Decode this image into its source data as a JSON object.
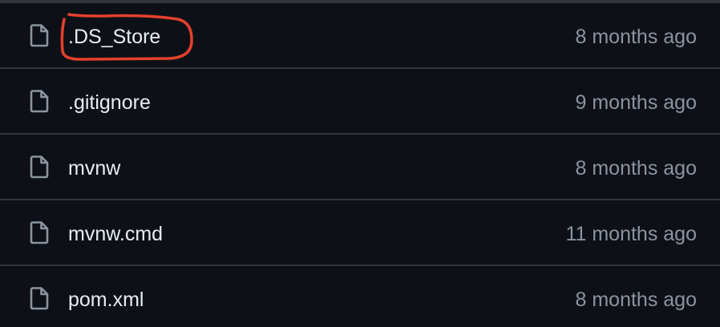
{
  "files": [
    {
      "name": ".DS_Store",
      "age": "8 months ago",
      "icon": "file-icon",
      "annotated": true
    },
    {
      "name": ".gitignore",
      "age": "9 months ago",
      "icon": "file-icon",
      "annotated": false
    },
    {
      "name": "mvnw",
      "age": "8 months ago",
      "icon": "file-icon",
      "annotated": false
    },
    {
      "name": "mvnw.cmd",
      "age": "11 months ago",
      "icon": "file-icon",
      "annotated": false
    },
    {
      "name": "pom.xml",
      "age": "8 months ago",
      "icon": "file-icon",
      "annotated": false
    }
  ],
  "colors": {
    "background": "#0d1117",
    "divider": "#30363d",
    "file_name": "#e6edf3",
    "age_text": "#8b949e",
    "icon_stroke": "#8b949e",
    "annotation": "#e5402c"
  }
}
